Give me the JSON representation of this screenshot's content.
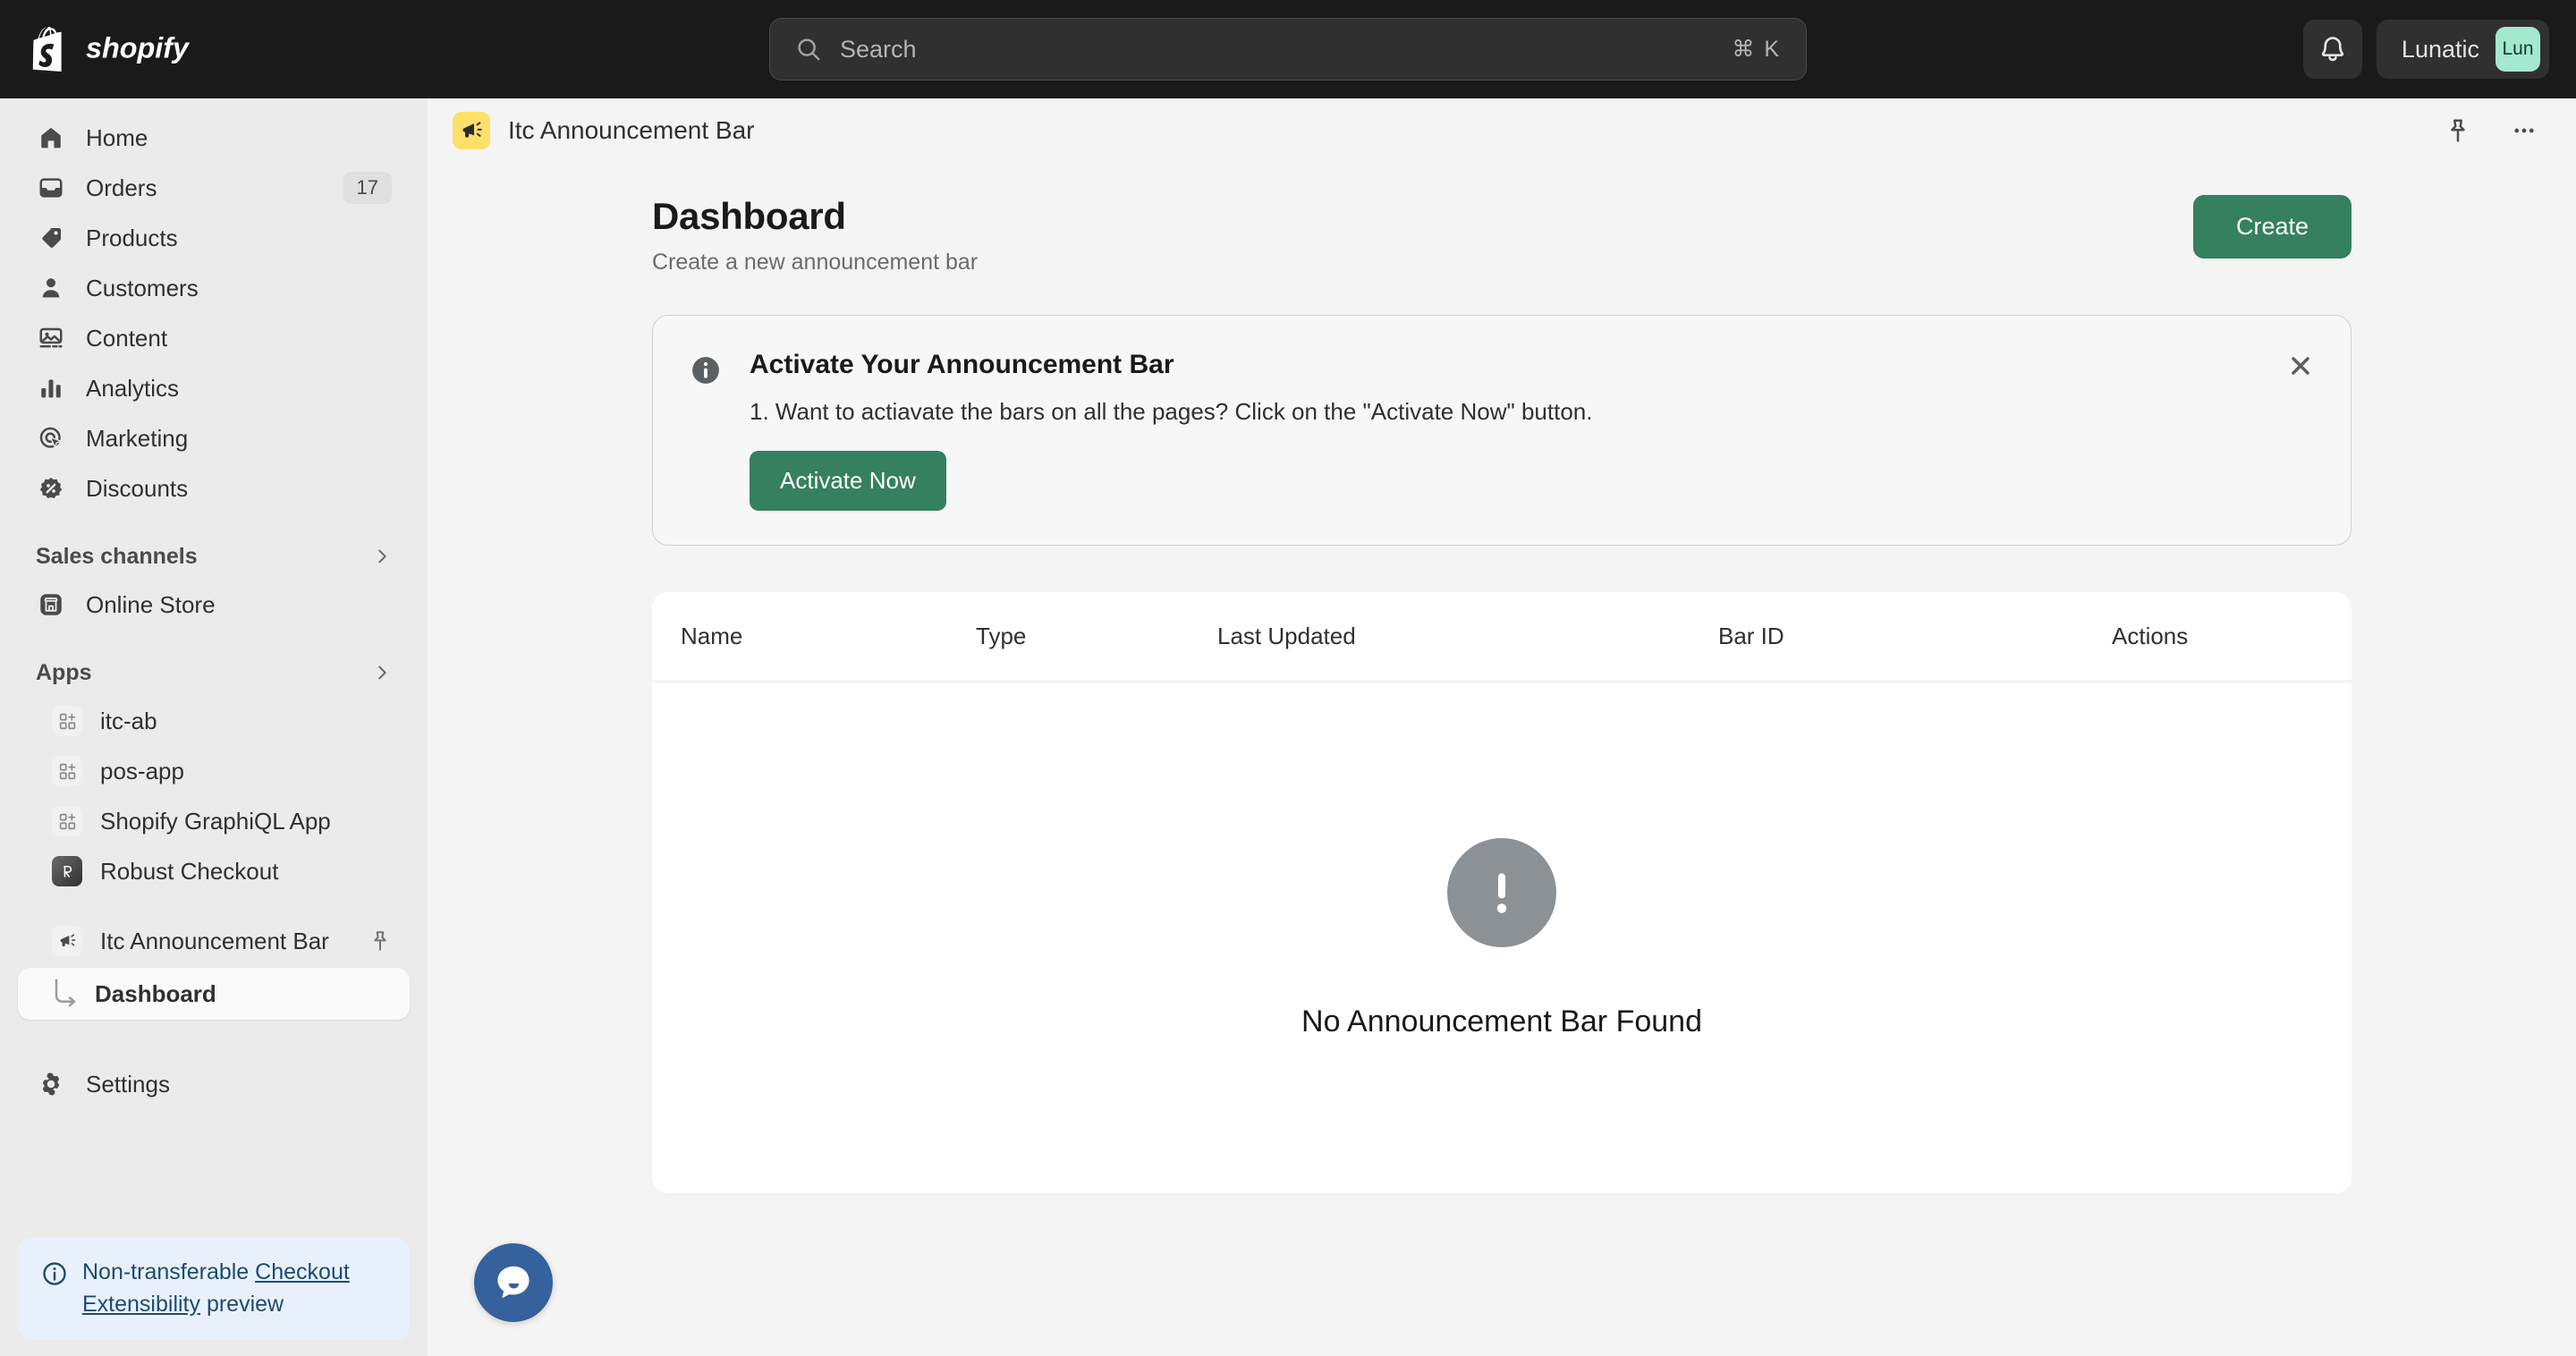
{
  "topbar": {
    "brand": "shopify",
    "search": {
      "placeholder": "Search",
      "shortcut": "⌘ K"
    },
    "notifications_label": "Notifications",
    "user": {
      "name": "Lunatic",
      "initials": "Lun"
    }
  },
  "sidebar": {
    "nav": [
      {
        "label": "Home",
        "icon": "home-icon"
      },
      {
        "label": "Orders",
        "icon": "orders-icon",
        "badge": "17"
      },
      {
        "label": "Products",
        "icon": "products-icon"
      },
      {
        "label": "Customers",
        "icon": "customers-icon"
      },
      {
        "label": "Content",
        "icon": "content-icon"
      },
      {
        "label": "Analytics",
        "icon": "analytics-icon"
      },
      {
        "label": "Marketing",
        "icon": "marketing-icon"
      },
      {
        "label": "Discounts",
        "icon": "discounts-icon"
      }
    ],
    "sales_channels": {
      "title": "Sales channels",
      "items": [
        {
          "label": "Online Store",
          "icon": "store-icon"
        }
      ]
    },
    "apps": {
      "title": "Apps",
      "items": [
        {
          "label": "itc-ab",
          "icon": "app-grid-icon"
        },
        {
          "label": "pos-app",
          "icon": "app-grid-icon"
        },
        {
          "label": "Shopify GraphiQL App",
          "icon": "app-grid-icon"
        },
        {
          "label": "Robust Checkout",
          "icon": "robust-checkout-icon"
        }
      ]
    },
    "active_app": {
      "label": "Itc Announcement Bar",
      "icon": "megaphone-icon",
      "sub_item": "Dashboard"
    },
    "settings": {
      "label": "Settings",
      "icon": "gear-icon"
    },
    "banner": {
      "lead": "Non-transferable",
      "link": "Checkout Extensibility",
      "trail": "preview"
    }
  },
  "app_header": {
    "title": "Itc Announcement Bar"
  },
  "page": {
    "title": "Dashboard",
    "subtitle": "Create a new announcement bar",
    "create_label": "Create"
  },
  "notice": {
    "title": "Activate Your Announcement Bar",
    "text": "1. Want to actiavate the bars on all the pages? Click on the \"Activate Now\" button.",
    "button_label": "Activate Now"
  },
  "table": {
    "columns": [
      "Name",
      "Type",
      "Last Updated",
      "Bar ID",
      "Actions"
    ],
    "rows": [],
    "empty_text": "No Announcement Bar Found"
  },
  "colors": {
    "topbar_bg": "#1a1a1a",
    "sidebar_bg": "#ebebeb",
    "main_bg": "#f4f4f4",
    "primary_green": "#35805e",
    "avatar_green": "#a4e8d0",
    "app_icon_yellow": "#fce06a",
    "banner_blue_bg": "#e8f1fb",
    "banner_blue_text": "#1f4a70",
    "empty_gray": "#8c9196",
    "chat_blue": "#35619d"
  }
}
